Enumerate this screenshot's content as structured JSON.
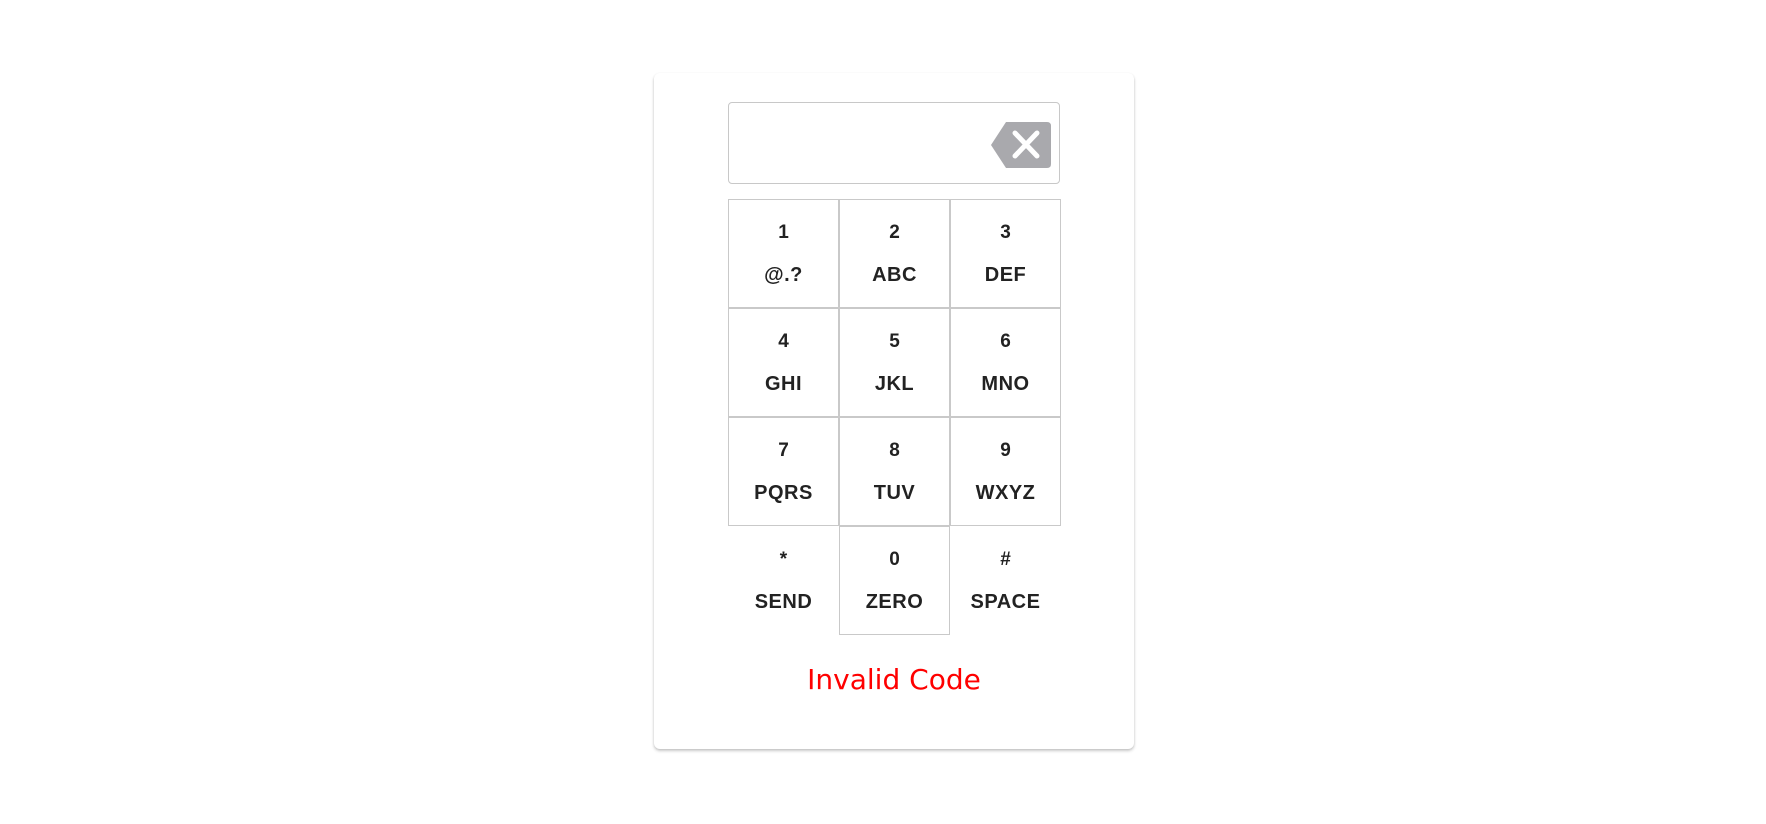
{
  "display": {
    "value": "",
    "clear_icon": "backspace-clear-icon",
    "clear_icon_color": "#a9a9ad"
  },
  "keys": [
    {
      "num": "1",
      "letters": "@.?"
    },
    {
      "num": "2",
      "letters": "ABC"
    },
    {
      "num": "3",
      "letters": "DEF"
    },
    {
      "num": "4",
      "letters": "GHI"
    },
    {
      "num": "5",
      "letters": "JKL"
    },
    {
      "num": "6",
      "letters": "MNO"
    },
    {
      "num": "7",
      "letters": "PQRS"
    },
    {
      "num": "8",
      "letters": "TUV"
    },
    {
      "num": "9",
      "letters": "WXYZ"
    },
    {
      "num": "*",
      "letters": "SEND"
    },
    {
      "num": "0",
      "letters": "ZERO"
    },
    {
      "num": "#",
      "letters": "SPACE"
    }
  ],
  "status": {
    "message": "Invalid Code",
    "color": "#ff0000"
  }
}
